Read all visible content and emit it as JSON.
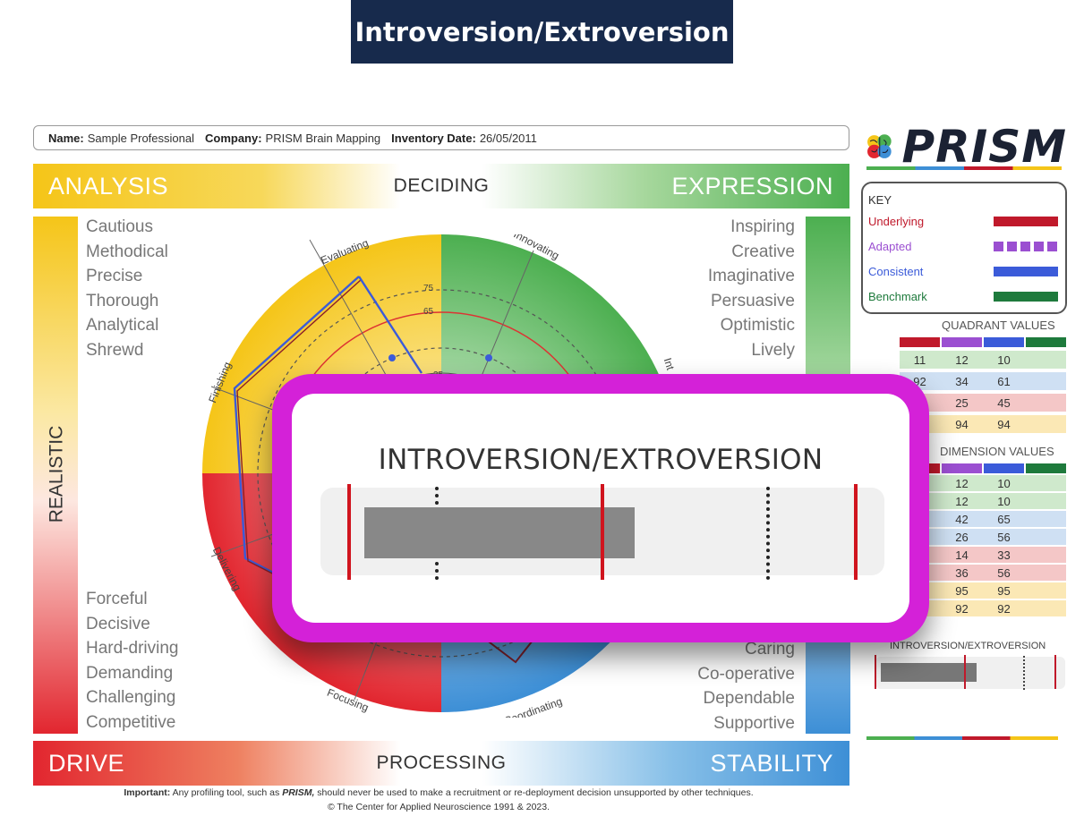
{
  "slide_title": "Introversion/Extroversion",
  "info": {
    "name_label": "Name:",
    "name_value": "Sample Professional",
    "company_label": "Company:",
    "company_value": "PRISM Brain Mapping",
    "date_label": "Inventory Date:",
    "date_value": "26/05/2011"
  },
  "top_band": {
    "left": "ANALYSIS",
    "center": "DECIDING",
    "right": "EXPRESSION"
  },
  "bottom_band": {
    "left": "DRIVE",
    "center": "PROCESSING",
    "right": "STABILITY"
  },
  "side_label": "REALISTIC",
  "traits_top_left": [
    "Cautious",
    "Methodical",
    "Precise",
    "Thorough",
    "Analytical",
    "Shrewd"
  ],
  "traits_bottom_left": [
    "Forceful",
    "Decisive",
    "Hard-driving",
    "Demanding",
    "Challenging",
    "Competitive"
  ],
  "traits_top_right": [
    "Inspiring",
    "Creative",
    "Imaginative",
    "Persuasive",
    "Optimistic",
    "Lively"
  ],
  "traits_bottom_right": [
    "Caring",
    "Co-operative",
    "Dependable",
    "Supportive"
  ],
  "wheel": {
    "labels": [
      "Evaluating",
      "Innovating",
      "Finishing",
      "Delivering",
      "Focusing",
      "Coordinating",
      "Int"
    ],
    "ring_labels": [
      "75",
      "65",
      "35"
    ]
  },
  "footer": {
    "line1_prefix": "Important:",
    "line1_a": "Any profiling tool, such as",
    "line1_brand": "PRISM,",
    "line1_b": "should never be used to make a recruitment or re-deployment decision unsupported by other techniques.",
    "line2": "© The Center for Applied Neuroscience 1991 & 2023."
  },
  "logo": {
    "text": "PRISM",
    "icon": "brain-icon"
  },
  "key": {
    "title": "KEY",
    "items": [
      {
        "label": "Underlying",
        "color": "#c0192b",
        "style": "solid"
      },
      {
        "label": "Adapted",
        "color": "#9b4fd1",
        "style": "dashed"
      },
      {
        "label": "Consistent",
        "color": "#3b5bd9",
        "style": "solid"
      },
      {
        "label": "Benchmark",
        "color": "#1e7a3c",
        "style": "solid"
      }
    ]
  },
  "quadrant_values": {
    "title": "QUADRANT VALUES",
    "header_colors": [
      "#c0192b",
      "#9b4fd1",
      "#3b5bd9",
      "#1e7a3c"
    ],
    "rows": [
      {
        "cells": [
          "11",
          "12",
          "10",
          ""
        ],
        "bg": "#cfe9cc"
      },
      {
        "cells": [
          "92",
          "34",
          "61",
          ""
        ],
        "bg": "#cfe0f3"
      },
      {
        "cells": [
          "",
          "25",
          "45",
          ""
        ],
        "bg": "#f4c7c7"
      },
      {
        "cells": [
          "",
          "94",
          "94",
          ""
        ],
        "bg": "#fbe8b5"
      }
    ]
  },
  "dimension_values": {
    "title": "DIMENSION VALUES",
    "rows": [
      {
        "cells": [
          "12",
          "10"
        ],
        "bg": "#cfe9cc"
      },
      {
        "cells": [
          "12",
          "10"
        ],
        "bg": "#cfe9cc"
      },
      {
        "cells": [
          "42",
          "65"
        ],
        "bg": "#cfe0f3"
      },
      {
        "cells": [
          "26",
          "56"
        ],
        "bg": "#cfe0f3"
      },
      {
        "cells": [
          "14",
          "33"
        ],
        "bg": "#f4c7c7"
      },
      {
        "cells": [
          "36",
          "56"
        ],
        "bg": "#f4c7c7"
      },
      {
        "cells": [
          "95",
          "95"
        ],
        "bg": "#fbe8b5"
      },
      {
        "cells": [
          "92",
          "92"
        ],
        "bg": "#fbe8b5"
      }
    ]
  },
  "mini_ie": {
    "title": "INTROVERSION/EXTROVERSION"
  },
  "callout": {
    "title": "INTROVERSION/EXTROVERSION",
    "border_color": "#d421d8"
  }
}
